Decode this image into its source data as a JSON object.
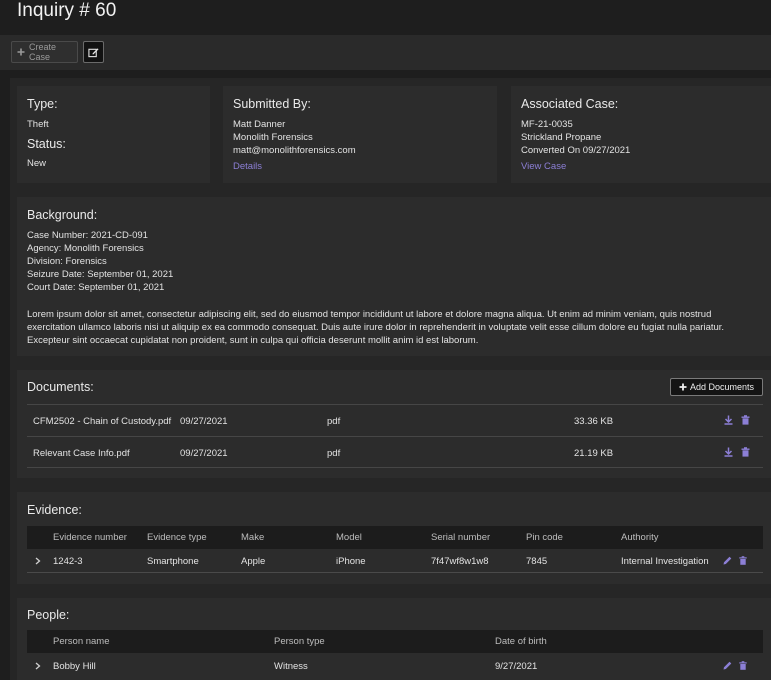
{
  "page": {
    "title": "Inquiry # 60"
  },
  "toolbar": {
    "create_case_label": "Create Case"
  },
  "summary": {
    "type_label": "Type:",
    "type_value": "Theft",
    "status_label": "Status:",
    "status_value": "New",
    "submitted_label": "Submitted By:",
    "submitter_name": "Matt Danner",
    "submitter_org": "Monolith Forensics",
    "submitter_email": "matt@monolithforensics.com",
    "details_link": "Details",
    "associated_label": "Associated Case:",
    "case_number": "MF-21-0035",
    "case_name": "Strickland Propane",
    "converted": "Converted On 09/27/2021",
    "view_case_link": "View Case"
  },
  "background": {
    "label": "Background:",
    "lines": [
      "Case Number: 2021-CD-091",
      "Agency: Monolith Forensics",
      "Division: Forensics",
      "Seizure Date: September 01, 2021",
      "Court Date: September 01, 2021"
    ],
    "paragraph": "Lorem ipsum dolor sit amet, consectetur adipiscing elit, sed do eiusmod tempor incididunt ut labore et dolore magna aliqua. Ut enim ad minim veniam, quis nostrud exercitation ullamco laboris nisi ut aliquip ex ea commodo consequat. Duis aute irure dolor in reprehenderit in voluptate velit esse cillum dolore eu fugiat nulla pariatur. Excepteur sint occaecat cupidatat non proident, sunt in culpa qui officia deserunt mollit anim id est laborum."
  },
  "documents": {
    "label": "Documents:",
    "add_label": "Add Documents",
    "rows": [
      {
        "name": "CFM2502 - Chain of Custody.pdf",
        "date": "09/27/2021",
        "type": "pdf",
        "size": "33.36 KB"
      },
      {
        "name": "Relevant Case Info.pdf",
        "date": "09/27/2021",
        "type": "pdf",
        "size": "21.19 KB"
      }
    ]
  },
  "evidence": {
    "label": "Evidence:",
    "columns": [
      "Evidence number",
      "Evidence type",
      "Make",
      "Model",
      "Serial number",
      "Pin code",
      "Authority"
    ],
    "rows": [
      [
        "1242-3",
        "Smartphone",
        "Apple",
        "iPhone",
        "7f47wf8w1w8",
        "7845",
        "Internal Investigation"
      ]
    ]
  },
  "people": {
    "label": "People:",
    "columns": [
      "Person name",
      "Person type",
      "Date of birth"
    ],
    "rows": [
      [
        "Bobby Hill",
        "Witness",
        "9/27/2021"
      ]
    ]
  },
  "colors": {
    "accent": "#8c7fd6",
    "background": "#1e1e1e",
    "card": "#2c2c2c"
  },
  "icons": [
    "plus-icon",
    "edit-icon",
    "download-icon",
    "trash-icon",
    "pencil-icon",
    "chevron-right-icon"
  ]
}
